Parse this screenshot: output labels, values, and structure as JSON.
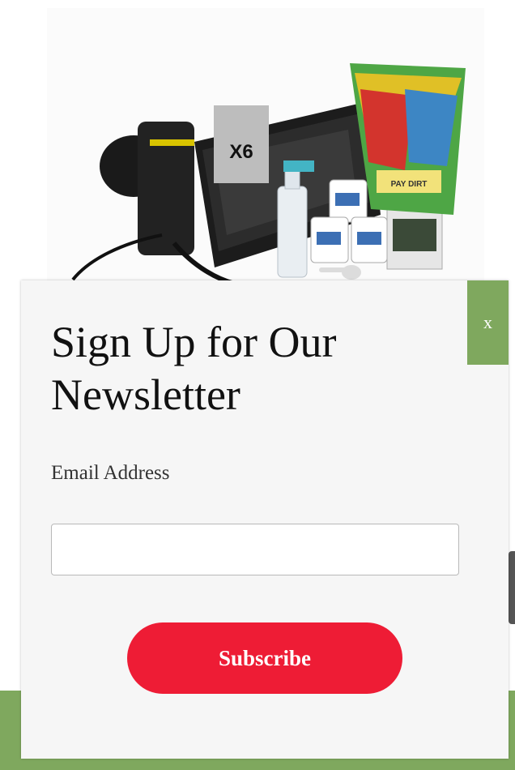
{
  "product": {
    "image_icon": "hydroponic-kit-image",
    "multiplier_label": "X6",
    "bag_label": "PAY DIRT"
  },
  "modal": {
    "close_label": "x",
    "title": "Sign Up for Our Newsletter",
    "email_label": "Email Address",
    "email_value": "",
    "email_placeholder": "",
    "subscribe_label": "Subscribe"
  },
  "colors": {
    "accent_green": "#7fa85e",
    "subscribe_red": "#ee1c35",
    "modal_background": "#f6f6f6"
  }
}
